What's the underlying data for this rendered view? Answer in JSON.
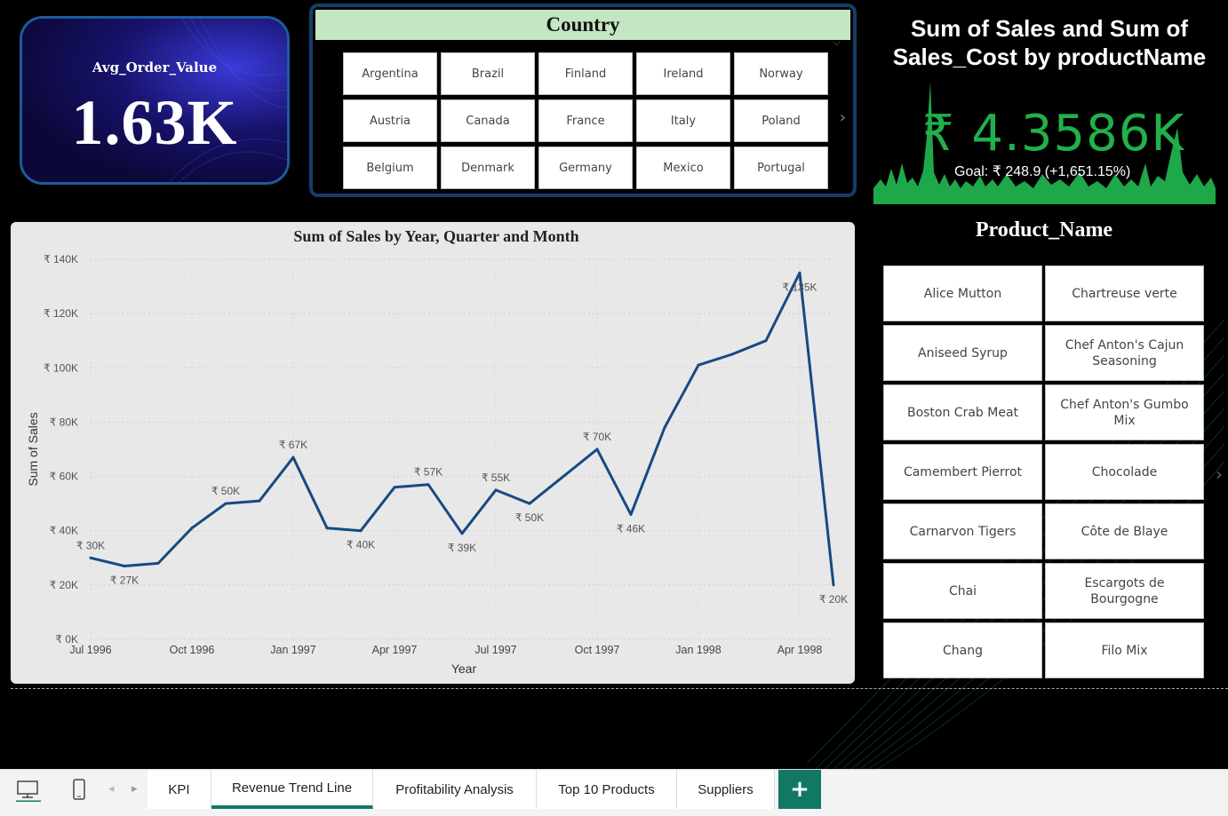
{
  "kpi": {
    "title": "Avg_Order_Value",
    "value": "1.63K"
  },
  "country_slicer": {
    "title": "Country",
    "items": [
      "Argentina",
      "Brazil",
      "Finland",
      "Ireland",
      "Norway",
      "Austria",
      "Canada",
      "France",
      "Italy",
      "Poland",
      "Belgium",
      "Denmark",
      "Germany",
      "Mexico",
      "Portugal"
    ]
  },
  "gauge": {
    "title_line1": "Sum of Sales and Sum of",
    "title_line2": "Sales_Cost by productName",
    "value": "₹ 4.3586K",
    "goal": "Goal: ₹ 248.9 (+1,651.15%)",
    "color": "#21b04a"
  },
  "product_slicer": {
    "title": "Product_Name",
    "items": [
      "Alice Mutton",
      "Chartreuse verte",
      "Aniseed Syrup",
      "Chef Anton's Cajun Seasoning",
      "Boston Crab Meat",
      "Chef Anton's Gumbo Mix",
      "Camembert Pierrot",
      "Chocolade",
      "Carnarvon Tigers",
      "Côte de Blaye",
      "Chai",
      "Escargots de Bourgogne",
      "Chang",
      "Filo Mix"
    ]
  },
  "chart_data": {
    "type": "line",
    "title": "Sum of Sales by Year, Quarter and Month",
    "xlabel": "Year",
    "ylabel": "Sum of Sales",
    "ylim": [
      0,
      140000
    ],
    "yticks": [
      "₹ 0K",
      "₹ 20K",
      "₹ 40K",
      "₹ 60K",
      "₹ 80K",
      "₹ 100K",
      "₹ 120K",
      "₹ 140K"
    ],
    "xticks": [
      "Jul 1996",
      "Oct 1996",
      "Jan 1997",
      "Apr 1997",
      "Jul 1997",
      "Oct 1997",
      "Jan 1998",
      "Apr 1998"
    ],
    "grid": true,
    "line_color": "#174a82",
    "x": [
      "Jul 1996",
      "Aug 1996",
      "Sep 1996",
      "Oct 1996",
      "Nov 1996",
      "Dec 1996",
      "Jan 1997",
      "Feb 1997",
      "Mar 1997",
      "Apr 1997",
      "May 1997",
      "Jun 1997",
      "Jul 1997",
      "Aug 1997",
      "Sep 1997",
      "Oct 1997",
      "Nov 1997",
      "Dec 1997",
      "Jan 1998",
      "Feb 1998",
      "Mar 1998",
      "Apr 1998",
      "May 1998"
    ],
    "values": [
      30000,
      27000,
      28000,
      41000,
      50000,
      51000,
      67000,
      41000,
      40000,
      56000,
      57000,
      39000,
      55000,
      50000,
      60000,
      70000,
      46000,
      78000,
      101000,
      105000,
      110000,
      135000,
      20000
    ],
    "data_labels": [
      {
        "index": 0,
        "text": "₹ 30K",
        "pos": "above"
      },
      {
        "index": 1,
        "text": "₹ 27K",
        "pos": "below"
      },
      {
        "index": 4,
        "text": "₹ 50K",
        "pos": "above"
      },
      {
        "index": 6,
        "text": "₹ 67K",
        "pos": "above"
      },
      {
        "index": 8,
        "text": "₹ 40K",
        "pos": "below"
      },
      {
        "index": 10,
        "text": "₹ 57K",
        "pos": "above"
      },
      {
        "index": 11,
        "text": "₹ 39K",
        "pos": "below"
      },
      {
        "index": 12,
        "text": "₹ 55K",
        "pos": "above"
      },
      {
        "index": 13,
        "text": "₹ 50K",
        "pos": "below"
      },
      {
        "index": 15,
        "text": "₹ 70K",
        "pos": "above"
      },
      {
        "index": 16,
        "text": "₹ 46K",
        "pos": "below"
      },
      {
        "index": 21,
        "text": "₹ 135K",
        "pos": "below"
      },
      {
        "index": 22,
        "text": "₹ 20K",
        "pos": "below"
      }
    ]
  },
  "tabs": [
    {
      "label": "KPI",
      "active": false
    },
    {
      "label": "Revenue Trend Line",
      "active": true
    },
    {
      "label": "Profitability Analysis",
      "active": false
    },
    {
      "label": "Top 10 Products",
      "active": false
    },
    {
      "label": "Suppliers",
      "active": false
    }
  ],
  "add_tab_label": "+"
}
